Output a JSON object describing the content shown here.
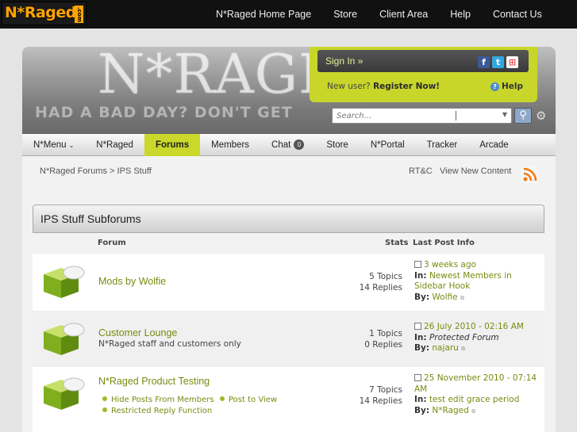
{
  "logo": {
    "text": "N*Raged",
    "suffix": ".com"
  },
  "topnav": [
    "N*Raged Home Page",
    "Store",
    "Client Area",
    "Help",
    "Contact Us"
  ],
  "banner": {
    "big": "N*RAGED",
    "slogan": "HAD A BAD DAY?  DON'T GET"
  },
  "signin": {
    "label": "Sign In »",
    "new_user": "New user?",
    "register": "Register Now!",
    "help": "Help",
    "social": [
      "f",
      "t",
      "⊞"
    ]
  },
  "search": {
    "placeholder": "Search...",
    "button": "⚲"
  },
  "mainnav": [
    {
      "label": "N*Menu",
      "caret": "⌄"
    },
    {
      "label": "N*Raged"
    },
    {
      "label": "Forums",
      "active": true
    },
    {
      "label": "Members"
    },
    {
      "label": "Chat",
      "badge": "0"
    },
    {
      "label": "Store"
    },
    {
      "label": "N*Portal"
    },
    {
      "label": "Tracker"
    },
    {
      "label": "Arcade"
    }
  ],
  "breadcrumb": {
    "root": "N*Raged Forums",
    "sep": ">",
    "current": "IPS Stuff"
  },
  "links": {
    "rtc": "RT&C",
    "view_new": "View New Content"
  },
  "category": {
    "title": "IPS Stuff Subforums",
    "col_forum": "Forum",
    "col_stats": "Stats",
    "col_last": "Last Post Info"
  },
  "forums": [
    {
      "title": "Mods by Wolfie",
      "topics": "5 Topics",
      "replies": "14 Replies",
      "last_date": "3 weeks ago",
      "in_label": "In:",
      "in_topic": "Newest Members in Sidebar Hook",
      "by_label": "By:",
      "by_user": "Wolfie"
    },
    {
      "title": "Customer Lounge",
      "desc": "N*Raged staff and customers only",
      "topics": "1 Topics",
      "replies": "0 Replies",
      "last_date": "26 July 2010 - 02:16 AM",
      "in_label": "In:",
      "in_topic": "Protected Forum",
      "by_label": "By:",
      "by_user": "najaru"
    },
    {
      "title": "N*Raged Product Testing",
      "subforums": [
        "Hide Posts From Members",
        "Post to View",
        "Restricted Reply Function"
      ],
      "topics": "7 Topics",
      "replies": "14 Replies",
      "last_date": "25 November 2010 - 07:14 AM",
      "in_label": "In:",
      "in_topic": "test edit grace period",
      "by_label": "By:",
      "by_user": "N*Raged"
    }
  ],
  "colors": {
    "accent": "#c9d82a",
    "link": "#7a8a10",
    "topbar": "#111111"
  }
}
